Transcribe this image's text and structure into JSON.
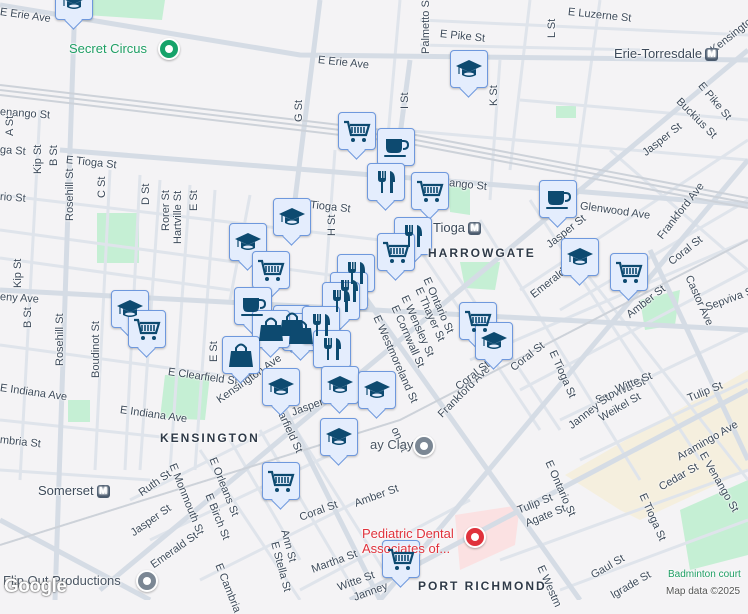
{
  "map": {
    "colors": {
      "background": "#f4f3f5",
      "road": "#d5dce5",
      "park": "#c5efd4",
      "industrial": "#f5efde",
      "hospital": "#fbe1e2",
      "pin_fill": "#e4edfd",
      "pin_icon": "#0d4a70"
    },
    "neighborhoods": [
      "KENSINGTON",
      "HARROWGATE",
      "PORT RICHMOND"
    ],
    "places": {
      "secret_circus": "Secret Circus",
      "flip_out": "Flip Out Productions",
      "pediatric": "Pediatric Dental\nAssociates of...",
      "clay": "ay Clay",
      "badminton": "Badminton court"
    },
    "stations": [
      "Erie-Torresdale",
      "Tioga",
      "Somerset"
    ],
    "metro_symbol": "M",
    "streets": [
      "E Erie Ave",
      "E Erie Ave",
      "enango St",
      "A St",
      "ga St",
      "Kip St",
      "B St",
      "E Tioga St",
      "Rosehill St",
      "C St",
      "D St",
      "Rorer St",
      "Hartville St",
      "E St",
      "G St",
      "E Tioga St",
      "H St",
      "rio St",
      "Kip St",
      "eny Ave",
      "B St",
      "Rosehill St",
      "Boudinot St",
      "E St",
      "E Clearfield St",
      "E Indiana Ave",
      "E Indiana Ave",
      "mbria St",
      "Kensington Ave",
      "Clearfield St",
      "Jasper",
      "Ruth St",
      "E Monmouth St",
      "E Orleans St",
      "E Birch St",
      "Jasper St",
      "Emerald St",
      "E Cambria",
      "Ann St",
      "E Stella St",
      "Coral St",
      "Amber St",
      "Martha St",
      "Witte St",
      "Janney",
      "E Luzerne St",
      "Palmetto St",
      "E Pike St",
      "L St",
      "Kensington",
      "I St",
      "K St",
      "E Pike St",
      "Buckius St",
      "Jasper St",
      "E Venango St",
      "Glenwood Ave",
      "Frankford Ave",
      "Jasper St",
      "Coral St",
      "Emerald",
      "E Ontario St",
      "E Thayer St",
      "E Wensley St",
      "E Cornwall St",
      "E Westmoreland St",
      "Amber St",
      "Castor Ave",
      "Sepviva St",
      "Frankford Ave",
      "Coral St",
      "Coral St",
      "E Tioga St",
      "Sepviva St",
      "Witte St",
      "Tulip St",
      "Janney St",
      "Weikel St",
      "Aramingo Ave",
      "E Ontario St",
      "Cedar St",
      "E Venango St",
      "E Tioga St",
      "Tulip St",
      "Agate St",
      "Gaul St",
      "lgrade St",
      "E Westm",
      "on St"
    ],
    "markers": [
      "school",
      "school",
      "cart",
      "coffee",
      "food",
      "cart",
      "coffee",
      "school",
      "food",
      "cart",
      "school",
      "cart",
      "food",
      "food",
      "food",
      "coffee",
      "school",
      "cart",
      "bag",
      "bag",
      "bag",
      "food",
      "bag",
      "food",
      "school",
      "school",
      "school",
      "school",
      "cart",
      "cart",
      "school",
      "school",
      "cart",
      "cart"
    ],
    "attribution": "Map data ©2025",
    "logo": "Google"
  }
}
